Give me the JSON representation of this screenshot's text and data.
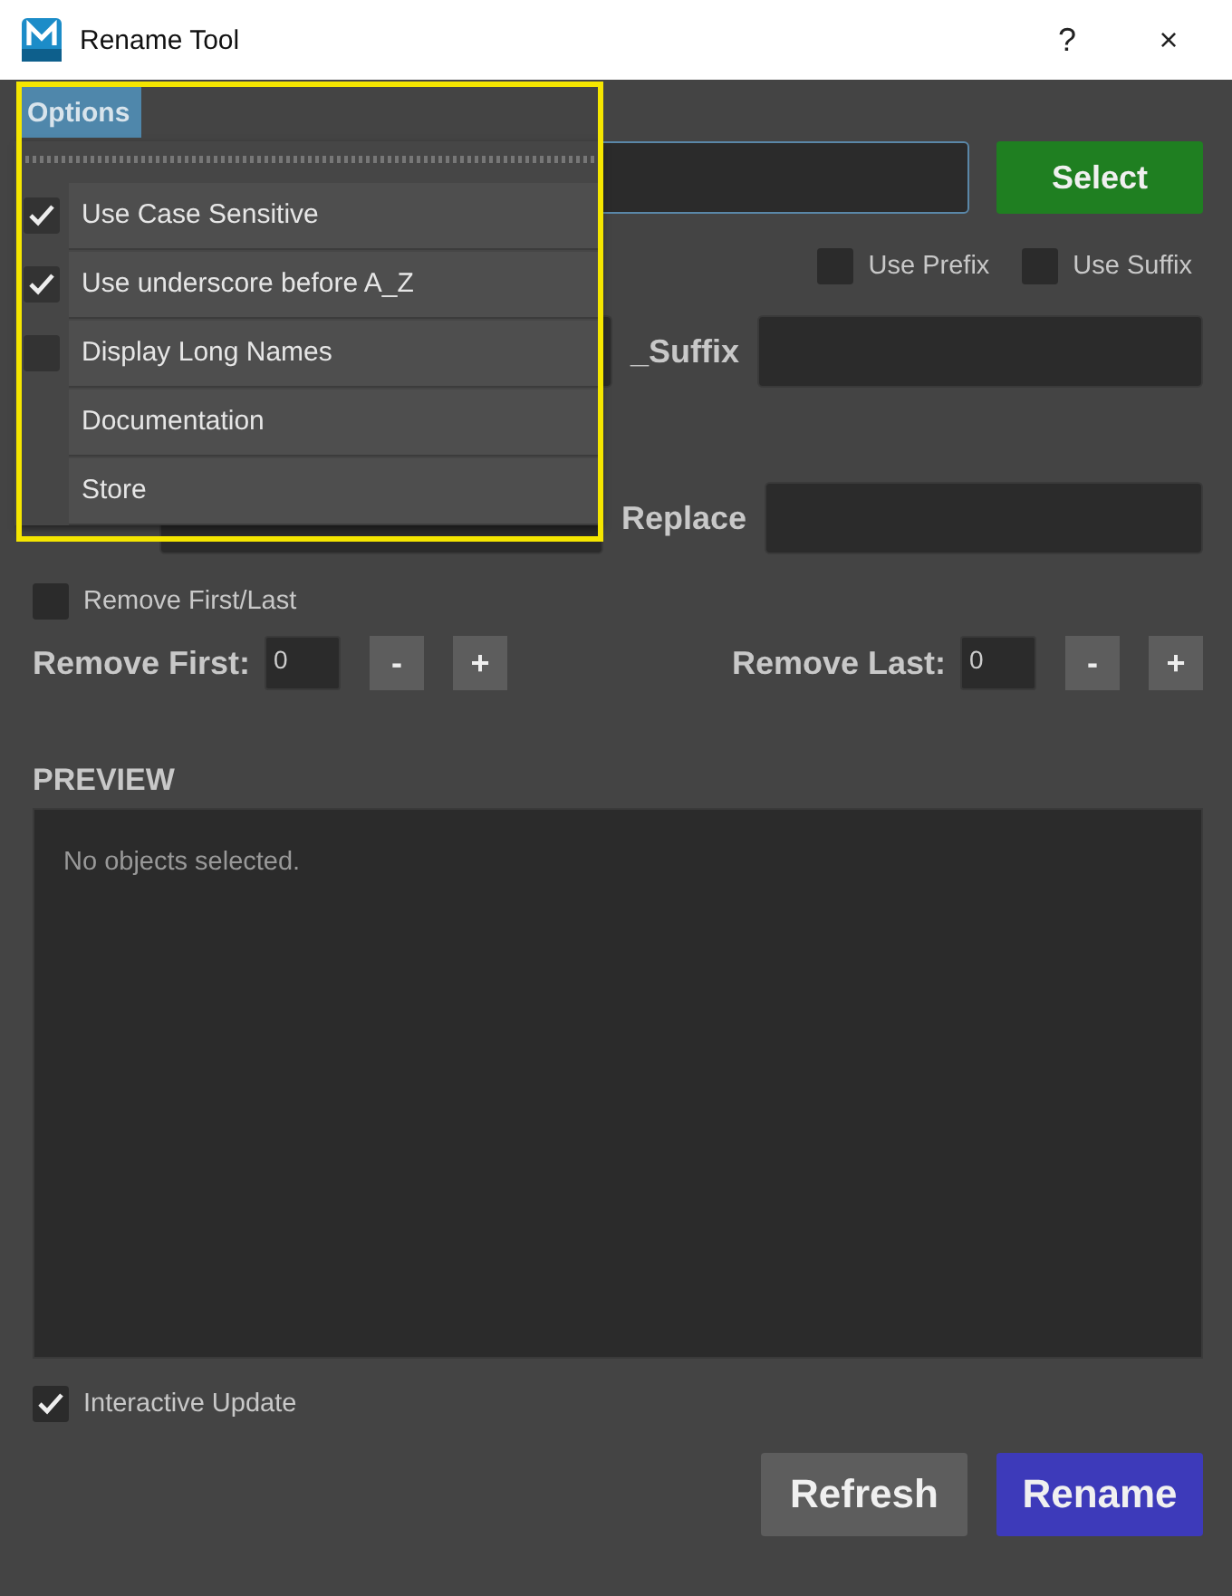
{
  "window": {
    "title": "Rename Tool",
    "help": "?",
    "close": "×"
  },
  "menu_bar": [
    {
      "label": "Options",
      "selected": true
    }
  ],
  "options_menu": {
    "highlighted": true,
    "items": [
      {
        "label": "Use Case Sensitive",
        "kind": "check",
        "checked": true
      },
      {
        "label": "Use underscore before A_Z",
        "kind": "check",
        "checked": true
      },
      {
        "label": "Display Long Names",
        "kind": "check",
        "checked": false
      },
      {
        "label": "Documentation",
        "kind": "action"
      },
      {
        "label": "Store",
        "kind": "action"
      }
    ]
  },
  "select_button": "Select",
  "affix_options": [
    {
      "label": "Use Prefix",
      "checked": false
    },
    {
      "label": "Use Suffix",
      "checked": false
    }
  ],
  "suffix_label": "_Suffix",
  "replace_label": "Replace",
  "remove_first_last": {
    "label": "Remove First/Last",
    "checked": false
  },
  "removers": [
    {
      "label": "Remove First:",
      "value": "0",
      "minus": "-",
      "plus": "+"
    },
    {
      "label": "Remove Last:",
      "value": "0",
      "minus": "-",
      "plus": "+"
    }
  ],
  "preview": {
    "heading": "PREVIEW",
    "message": "No objects selected."
  },
  "interactive_update": {
    "label": "Interactive Update",
    "checked": true
  },
  "buttons": [
    {
      "label": "Refresh",
      "kind": "secondary"
    },
    {
      "label": "Rename",
      "kind": "primary"
    }
  ]
}
